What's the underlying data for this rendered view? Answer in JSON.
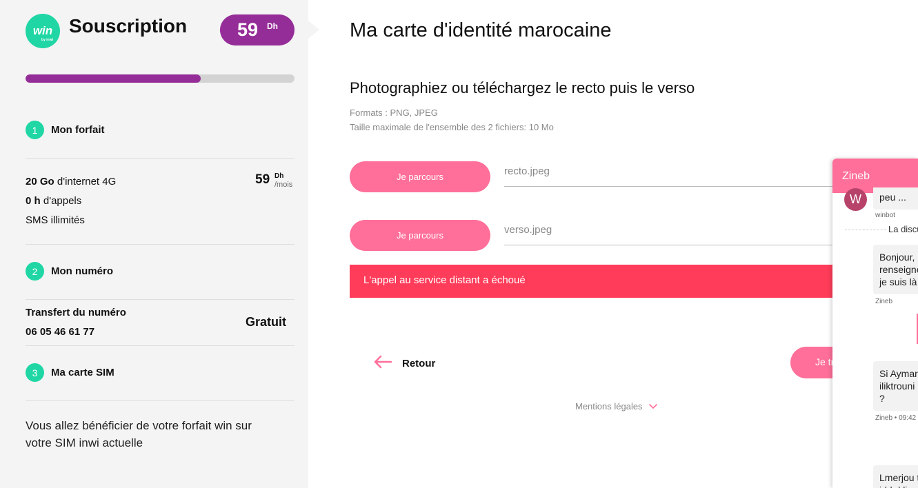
{
  "sidebar": {
    "logo_text": "win",
    "logo_sub": "by inwi",
    "title": "Souscription",
    "price": "59",
    "currency": "Dh",
    "progress_fraction": 0.65,
    "steps": [
      {
        "number": "1",
        "title": "Mon forfait"
      },
      {
        "number": "2",
        "title": "Mon numéro"
      },
      {
        "number": "3",
        "title": "Ma carte SIM"
      }
    ],
    "plan": {
      "data_amount": "20 Go",
      "data_label": "d'internet 4G",
      "calls_amount": "0 h",
      "calls_label": "d'appels",
      "sms": "SMS illimités",
      "price": "59",
      "price_currency": "Dh",
      "price_period": "/mois"
    },
    "number": {
      "transfer_label": "Transfert du numéro",
      "phone": "06 05 46 61 77",
      "price": "Gratuit"
    },
    "sim_info": "Vous allez bénéficier de votre forfait win sur votre SIM inwi actuelle"
  },
  "main": {
    "title": "Ma carte d'identité marocaine",
    "subtitle": "Photographiez ou téléchargez le recto puis le verso",
    "formats": "Formats : PNG, JPEG",
    "max_size": "Taille maximale de l'ensemble des 2 fichiers: 10 Mo",
    "browse_label": "Je parcours",
    "recto_file": "recto.jpeg",
    "verso_file": "verso.jpeg",
    "error": "L'appel au service distant a échoué",
    "back_label": "Retour",
    "next_label": "Je tr",
    "legal": "Mentions légales"
  },
  "chat": {
    "agent_name": "Zineb",
    "avatar_letter": "W",
    "msg1": "peu ...",
    "msg1_meta": "winbot",
    "system_text": "La discu",
    "msg2": "Bonjour, \nrenseigne\nje suis là",
    "msg2_meta": "Zineb",
    "msg3": "Si Aymar\niliktrouni\n?",
    "msg3_meta": "Zineb • 09:42",
    "msg4": "Lmerjou t\nidd d li"
  },
  "colors": {
    "brand_green": "#1fd6a4",
    "brand_purple": "#952d98",
    "accent_pink": "#ff6f9a",
    "error_red": "#ff3c5a"
  }
}
